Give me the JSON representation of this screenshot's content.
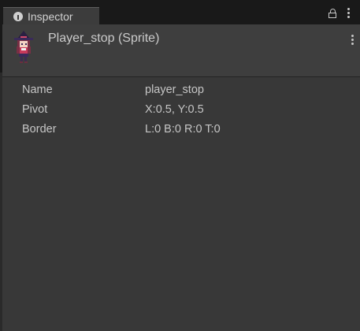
{
  "tab": {
    "label": "Inspector",
    "icon": "info-icon"
  },
  "header": {
    "title": "Player_stop (Sprite)"
  },
  "properties": [
    {
      "key": "Name",
      "value": "player_stop"
    },
    {
      "key": "Pivot",
      "value": "X:0.5, Y:0.5"
    },
    {
      "key": "Border",
      "value": "L:0 B:0 R:0 T:0"
    }
  ],
  "colors": {
    "background": "#191919",
    "panel": "#383838",
    "header": "#3e3e3e",
    "tab": "#3c3c3c",
    "text": "#c6c6c6"
  }
}
